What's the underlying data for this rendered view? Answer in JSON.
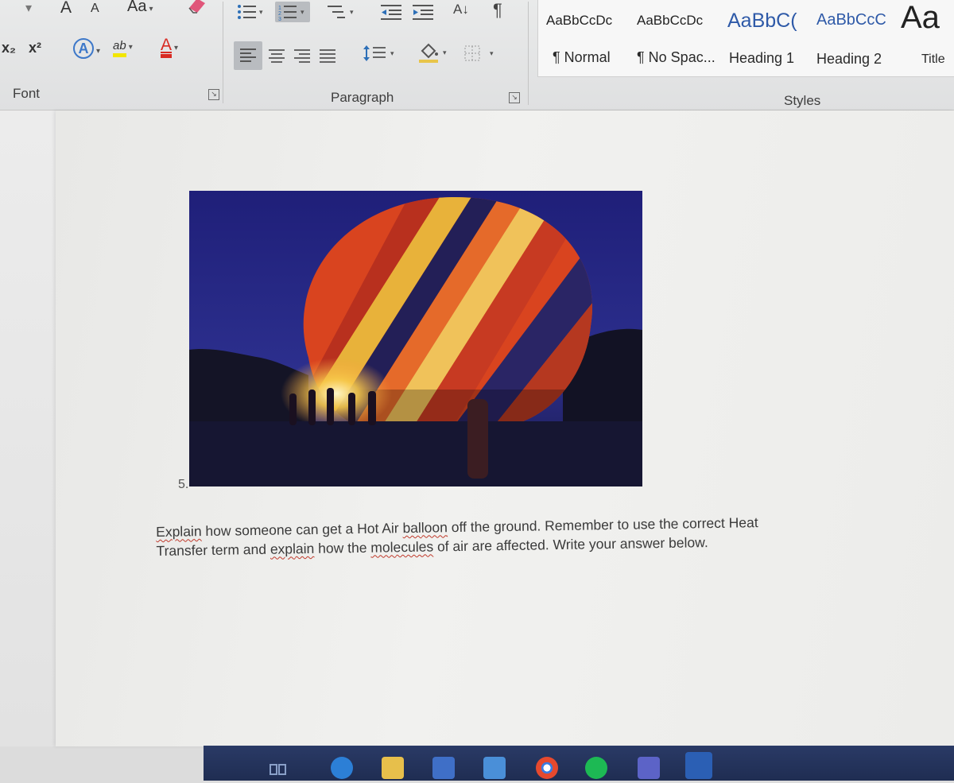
{
  "ribbon": {
    "font_group": {
      "label": "Font",
      "grow_font": "A",
      "shrink_font": "A",
      "change_case": "Aa",
      "subscript": "x₂",
      "superscript": "x²",
      "text_effects": "A",
      "highlight": "ab",
      "font_color": "A"
    },
    "paragraph_group": {
      "label": "Paragraph",
      "sort_icon": "A↓",
      "pilcrow": "¶"
    },
    "styles_group": {
      "label": "Styles",
      "styles": [
        {
          "preview": "AaBbCcDc",
          "name": "¶ Normal"
        },
        {
          "preview": "AaBbCcDc",
          "name": "¶ No Spac..."
        },
        {
          "preview": "AaBbC(",
          "name": "Heading 1"
        },
        {
          "preview": "AaBbCcC",
          "name": "Heading 2"
        },
        {
          "preview": "Aa",
          "name": "Title"
        }
      ]
    },
    "colors": {
      "highlight_yellow": "#f2e600",
      "font_color_red": "#d82a22",
      "text_effects_blue": "#3d78c9",
      "heading_blue": "#2f5aa8"
    }
  },
  "document": {
    "list_number": "5.",
    "question_line1_parts": [
      "Explain",
      " how someone can get a Hot Air ",
      "balloon",
      " off the ground. Remember to use the correct Heat"
    ],
    "question_line2_parts": [
      "Transfer term and ",
      "explain",
      " how the ",
      "molecules",
      " of air are affected. Write your answer below."
    ],
    "image_icon": "hot-air-balloon-photo"
  },
  "taskbar": {
    "icons": [
      "taskview-icon",
      "edge-icon",
      "file-explorer-icon",
      "store-icon",
      "photos-icon",
      "chrome-icon",
      "spotify-icon",
      "teams-icon",
      "word-icon"
    ]
  }
}
